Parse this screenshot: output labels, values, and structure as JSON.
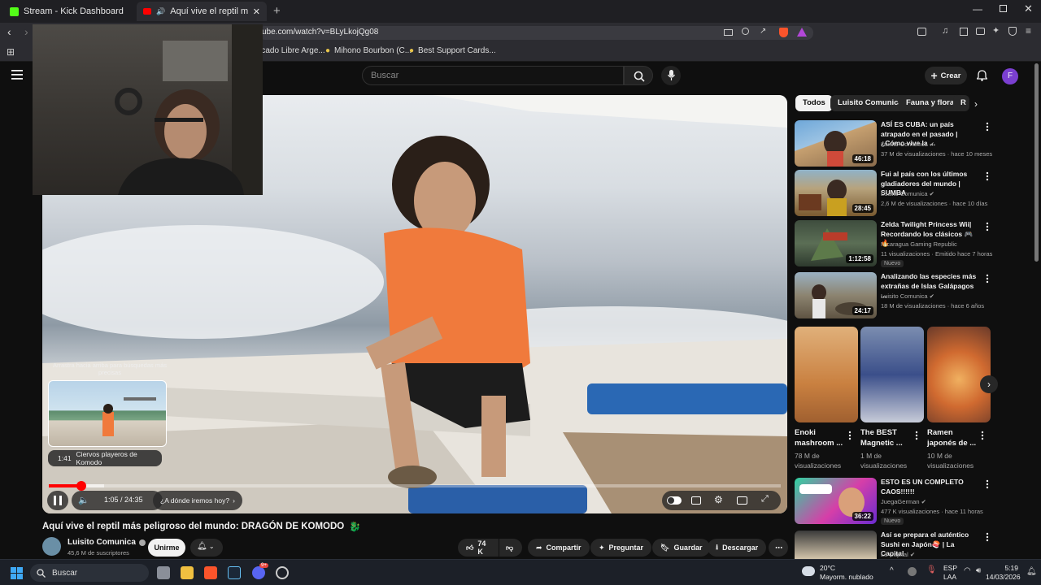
{
  "browser": {
    "tabs": [
      {
        "title": "Stream - Kick Dashboard",
        "active": false
      },
      {
        "title": "Aquí vive el reptil más peligroso",
        "active": true
      }
    ],
    "url": "ube.com/watch?v=BLyLkojQg08",
    "bookmarks": [
      "rcado Libre Arge...",
      "Mihono Bourbon (C...",
      "Best Support Cards..."
    ]
  },
  "youtube": {
    "search_placeholder": "Buscar",
    "create_label": "Crear",
    "avatar_letter": "F",
    "chips": [
      "Todos",
      "Luisito Comunica",
      "Fauna y flora",
      "R"
    ],
    "video": {
      "title": "Aquí vive el reptil más peligroso del mundo: DRAGÓN DE KOMODO",
      "time": "1:05 / 24:35",
      "chapter_button": "¿A dónde iremos hoy?",
      "progress_fraction": 0.044,
      "drag_hint": "Arrastra hacia arriba para búsquedas más precisas",
      "preview_time": "1:41",
      "preview_label": "Ciervos playeros de Komodo"
    },
    "channel": {
      "name": "Luisito Comunica",
      "subscribers": "45,6 M de suscriptores",
      "join_label": "Unirme"
    },
    "actions": {
      "likes": "74 K",
      "share": "Compartir",
      "ask": "Preguntar",
      "save": "Guardar",
      "download": "Descargar"
    },
    "recommendations": [
      {
        "title": "ASÍ ES CUBA: un país atrapado en el pasado | ¿Cómo vive la ...",
        "channel": "Luisito Comunica",
        "stats": "37 M de visualizaciones · hace 10 meses",
        "duration": "46:18",
        "new": false
      },
      {
        "title": "Fui al país con los últimos gladiadores del mundo | SUMBA",
        "channel": "Luisito Comunica",
        "stats": "2,6 M de visualizaciones · hace 10 días",
        "duration": "28:45",
        "new": false
      },
      {
        "title": "Zelda Twilight Princess Wii| Recordando los clásicos 🎮🔥",
        "channel": "Nicaragua Gaming Republic",
        "stats": "11 visualizaciones · Emitido hace 7 horas",
        "duration": "1:12:58",
        "new": true
      },
      {
        "title": "Analizando las especies más extrañas de Islas Galápagos ...",
        "channel": "Luisito Comunica",
        "stats": "18 M de visualizaciones · hace 6 años",
        "duration": "24:17",
        "new": false
      }
    ],
    "shorts": [
      {
        "title": "Enoki mashroom ...",
        "views": "78 M de visualizaciones"
      },
      {
        "title": "The BEST Magnetic ...",
        "views": "1 M de visualizaciones"
      },
      {
        "title": "Ramen japonés de ...",
        "views": "10 M de visualizaciones"
      }
    ],
    "more_recs": [
      {
        "title": "ESTO ES UN COMPLETO CAOS!!!!!!",
        "channel": "JuegaGerman",
        "stats": "477 K visualizaciones · hace 11 horas",
        "duration": "36:22",
        "new": true
      },
      {
        "title": "Así se prepara el auténtico Sushi en Japón🍣 | La Capital",
        "channel": "La Capital",
        "stats": "",
        "duration": "",
        "new": false
      }
    ],
    "new_label": "Nuevo"
  },
  "taskbar": {
    "search": "Buscar",
    "weather_temp": "20°C",
    "weather_desc": "Mayorm. nublado",
    "lang1": "ESP",
    "lang2": "LAA",
    "time": "5:19",
    "date": "14/03/2026",
    "discord_badge": "9+"
  },
  "colors": {
    "youtube_red": "#ff0000",
    "kick_green": "#53fc18",
    "avatar_purple": "#7b3fd1"
  }
}
